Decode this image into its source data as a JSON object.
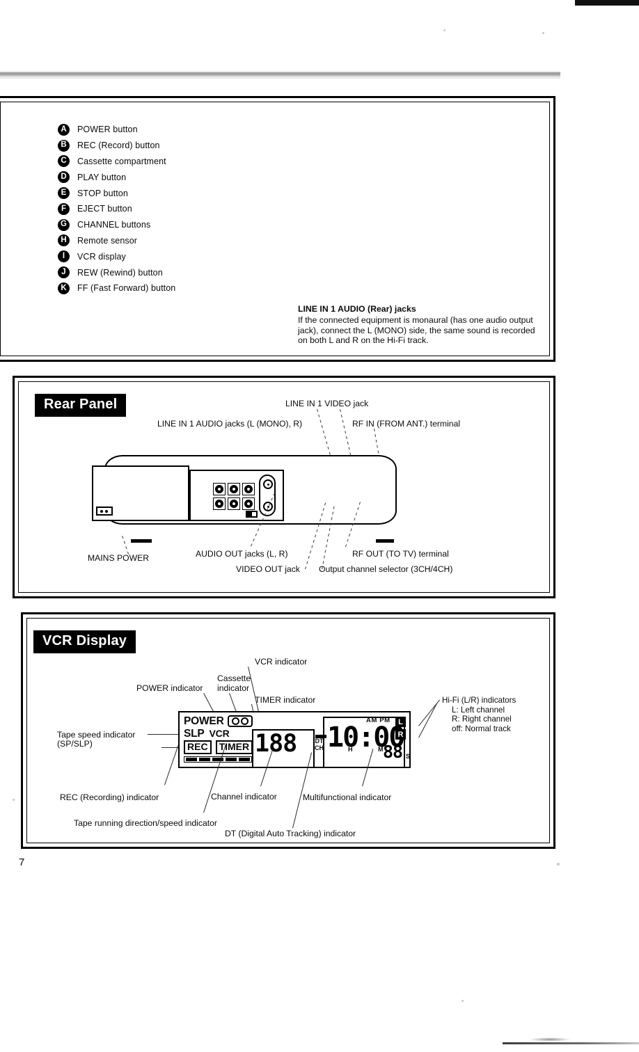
{
  "page": {
    "number": "7"
  },
  "callouts": {
    "items": [
      {
        "key": "A",
        "label": "POWER button"
      },
      {
        "key": "B",
        "label": "REC (Record) button"
      },
      {
        "key": "C",
        "label": "Cassette compartment"
      },
      {
        "key": "D",
        "label": "PLAY button"
      },
      {
        "key": "E",
        "label": "STOP button"
      },
      {
        "key": "F",
        "label": "EJECT button"
      },
      {
        "key": "G",
        "label": "CHANNEL buttons"
      },
      {
        "key": "H",
        "label": "Remote sensor"
      },
      {
        "key": "I",
        "label": "VCR display"
      },
      {
        "key": "J",
        "label": "REW (Rewind) button"
      },
      {
        "key": "K",
        "label": "FF (Fast Forward) button"
      }
    ]
  },
  "note": {
    "title": "LINE IN 1 AUDIO (Rear) jacks",
    "line1": "If the connected equipment is monaural (has one audio output",
    "line2": "jack), connect the L (MONO) side, the same sound is recorded",
    "line3": "on both L and R on the Hi-Fi track."
  },
  "rear_panel": {
    "title": "Rear Panel",
    "labels": {
      "line_in_video": "LINE IN 1 VIDEO jack",
      "line_in_audio": "LINE IN 1 AUDIO jacks (L (MONO), R)",
      "rf_in": "RF IN (FROM ANT.) terminal",
      "mains_power": "MAINS POWER",
      "audio_out": "AUDIO OUT jacks (L, R)",
      "video_out": "VIDEO OUT jack",
      "output_channel_selector": "Output channel selector (3CH/4CH)",
      "rf_out": "RF OUT (TO TV) terminal"
    }
  },
  "vcr_display": {
    "title": "VCR Display",
    "labels": {
      "power_indicator": "POWER indicator",
      "cassette_indicator_l1": "Cassette",
      "cassette_indicator_l2": "indicator",
      "vcr_indicator": "VCR indicator",
      "timer_indicator": "TIMER indicator",
      "tape_speed_l1": "Tape speed indicator",
      "tape_speed_l2": "(SP/SLP)",
      "rec_indicator": "REC (Recording) indicator",
      "tape_running": "Tape running direction/speed indicator",
      "channel_indicator": "Channel indicator",
      "dt_indicator": "DT (Digital Auto Tracking) indicator",
      "multifunctional_indicator": "Multifunctional indicator",
      "hifi_title": "Hi-Fi (L/R) indicators",
      "hifi_l": "L:   Left channel",
      "hifi_r": "R:  Right channel",
      "hifi_off": "off: Normal track"
    },
    "lcd": {
      "power_text": "POWER",
      "slp_text": "SLP",
      "rec_text": "REC",
      "vcr_text": "VCR",
      "timer_text": "TIMER",
      "cassette_icon": "cassette-reels-icon",
      "channel_value": "188",
      "dt_text": "DT",
      "ch_text": "CH",
      "clock_value": "10:00",
      "seconds_value": "88",
      "am_pm": "AM PM",
      "hour_unit": "H",
      "minute_unit": "M",
      "second_unit": "S",
      "left_channel_text": "L",
      "right_channel_text": "R"
    }
  }
}
